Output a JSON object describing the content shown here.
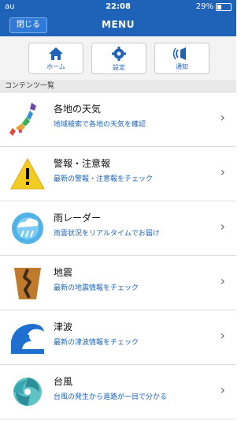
{
  "status": {
    "carrier": "au",
    "time": "22:08",
    "battery_percent": "29%",
    "battery_level": 0.29
  },
  "nav": {
    "close_label": "閉じる",
    "title": "MENU"
  },
  "quick": [
    {
      "label": "ホーム",
      "icon": "home-icon"
    },
    {
      "label": "設定",
      "icon": "gear-icon"
    },
    {
      "label": "通知",
      "icon": "notification-icon"
    }
  ],
  "section": {
    "title": "コンテンツ一覧"
  },
  "items": [
    {
      "title": "各地の天気",
      "desc": "地域検索で各地の天気を確認",
      "icon": "japan-map-icon"
    },
    {
      "title": "警報・注意報",
      "desc": "最新の警報・注意報をチェック",
      "icon": "warning-icon"
    },
    {
      "title": "雨レーダー",
      "desc": "雨雲状況をリアルタイムでお届け",
      "icon": "rain-radar-icon"
    },
    {
      "title": "地震",
      "desc": "最新の地震情報をチェック",
      "icon": "earthquake-icon"
    },
    {
      "title": "津波",
      "desc": "最新の津波情報をチェック",
      "icon": "tsunami-icon"
    },
    {
      "title": "台風",
      "desc": "台風の発生から進路が一目で分かる",
      "icon": "typhoon-icon"
    }
  ],
  "colors": {
    "primary": "#1e63b8",
    "link": "#1e63b8"
  }
}
